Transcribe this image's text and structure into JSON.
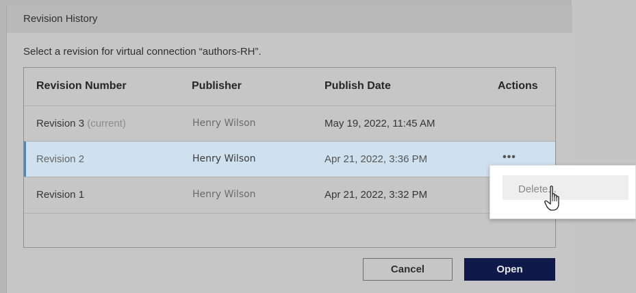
{
  "dialog": {
    "title": "Revision History",
    "instructions": "Select a revision for virtual connection “authors-RH”."
  },
  "table": {
    "headers": {
      "revision": "Revision Number",
      "publisher": "Publisher",
      "date": "Publish Date",
      "actions": "Actions"
    },
    "rows": [
      {
        "revision": "Revision 3",
        "tag": "(current)",
        "publisher": "Henry Wilson",
        "date": "May 19, 2022, 11:45 AM",
        "selected": false
      },
      {
        "revision": "Revision 2",
        "tag": "",
        "publisher": "Henry Wilson",
        "date": "Apr 21, 2022, 3:36 PM",
        "selected": true,
        "actions": "•••"
      },
      {
        "revision": "Revision 1",
        "tag": "",
        "publisher": "Henry Wilson",
        "date": "Apr 21, 2022, 3:32 PM",
        "selected": false
      }
    ]
  },
  "context_menu": {
    "delete_label": "Delete..."
  },
  "buttons": {
    "cancel": "Cancel",
    "open": "Open"
  },
  "colors": {
    "selected_row": "#cfe0ee",
    "selection_accent": "#4a88c0",
    "primary_button": "#0f1a4a"
  },
  "icons": {
    "more_actions": "ellipsis-icon",
    "cursor": "hand-pointer-icon"
  }
}
